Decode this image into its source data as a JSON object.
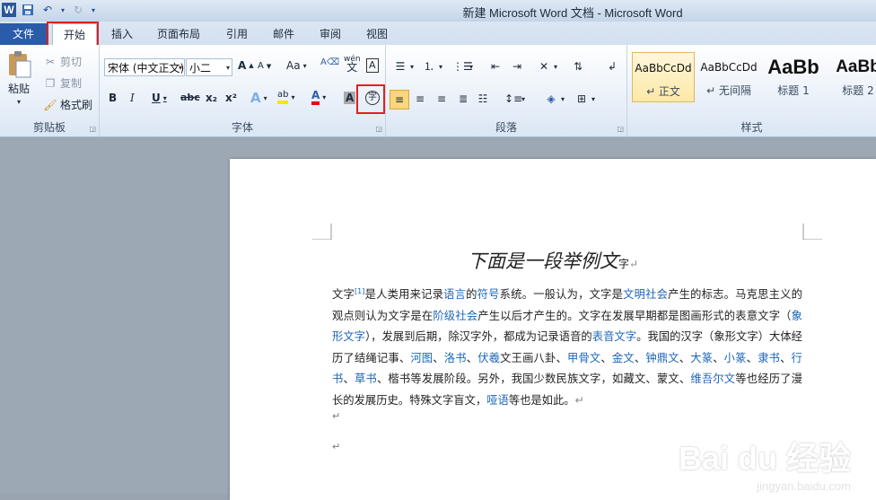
{
  "window": {
    "title": "新建 Microsoft Word 文档 - Microsoft Word"
  },
  "qat": {
    "word_icon": "W"
  },
  "tabs": [
    "文件",
    "开始",
    "插入",
    "页面布局",
    "引用",
    "邮件",
    "审阅",
    "视图"
  ],
  "clipboard": {
    "paste": "粘贴",
    "cut": "剪切",
    "copy": "复制",
    "format_painter": "格式刷",
    "group": "剪贴板"
  },
  "font": {
    "name": "宋体 (中文正文)",
    "size": "小二",
    "group": "字体",
    "bold": "B",
    "italic": "I",
    "underline": "U",
    "strike": "abc",
    "sub": "x₂",
    "sup": "x²",
    "grow": "A",
    "shrink": "A",
    "case": "Aa",
    "pinyin": "wén",
    "border_char": "A",
    "highlight": "ab",
    "color": "A",
    "shade": "A",
    "enclose": "字"
  },
  "paragraph": {
    "group": "段落"
  },
  "styles": {
    "group": "样式",
    "items": [
      {
        "sample": "AaBbCcDd",
        "name": "↵ 正文"
      },
      {
        "sample": "AaBbCcDd",
        "name": "↵ 无间隔"
      },
      {
        "sample": "AaBb",
        "name": "标题 1"
      },
      {
        "sample": "AaBb",
        "name": "标题 2"
      }
    ]
  },
  "document": {
    "title": "下面是一段举例文",
    "title_tail": "字",
    "segments": [
      {
        "t": "文字",
        "l": false
      },
      {
        "t": "[1]",
        "l": true,
        "sup": true
      },
      {
        "t": "是人类用来记录",
        "l": false
      },
      {
        "t": "语言",
        "l": true
      },
      {
        "t": "的",
        "l": false
      },
      {
        "t": "符号",
        "l": true
      },
      {
        "t": "系统。一般认为，文字是",
        "l": false
      },
      {
        "t": "文明社会",
        "l": true
      },
      {
        "t": "产生的标志。马克思主义的观点则认为文字是在",
        "l": false
      },
      {
        "t": "阶级社会",
        "l": true
      },
      {
        "t": "产生以后才产生的。文字在发展早期都是图画形式的表意文字（",
        "l": false
      },
      {
        "t": "象形文字",
        "l": true
      },
      {
        "t": "），发展到后期，除汉字外，都成为记录语音的",
        "l": false
      },
      {
        "t": "表音文字",
        "l": true
      },
      {
        "t": "。我国的汉字（象形文字）大体经历了结绳记事、",
        "l": false
      },
      {
        "t": "河图",
        "l": true
      },
      {
        "t": "、",
        "l": false
      },
      {
        "t": "洛书",
        "l": true
      },
      {
        "t": "、",
        "l": false
      },
      {
        "t": "伏羲",
        "l": true
      },
      {
        "t": "文王画八卦、",
        "l": false
      },
      {
        "t": "甲骨文",
        "l": true
      },
      {
        "t": "、",
        "l": false
      },
      {
        "t": "金文",
        "l": true
      },
      {
        "t": "、",
        "l": false
      },
      {
        "t": "钟鼎文",
        "l": true
      },
      {
        "t": "、",
        "l": false
      },
      {
        "t": "大篆",
        "l": true
      },
      {
        "t": "、",
        "l": false
      },
      {
        "t": "小篆",
        "l": true
      },
      {
        "t": "、",
        "l": false
      },
      {
        "t": "隶书",
        "l": true
      },
      {
        "t": "、",
        "l": false
      },
      {
        "t": "行书",
        "l": true
      },
      {
        "t": "、",
        "l": false
      },
      {
        "t": "草书",
        "l": true
      },
      {
        "t": "、楷书等发展阶段。另外，我国少数民族文字，如藏文、蒙文、",
        "l": false
      },
      {
        "t": "维吾尔文",
        "l": true
      },
      {
        "t": "等也经历了漫长的发展历史。特殊文字盲文，",
        "l": false
      },
      {
        "t": "哑语",
        "l": true
      },
      {
        "t": "等也是如此。",
        "l": false
      }
    ],
    "para_mark": "↵"
  },
  "watermark": {
    "text": "Bai du 经验",
    "url": "jingyan.baidu.com"
  }
}
